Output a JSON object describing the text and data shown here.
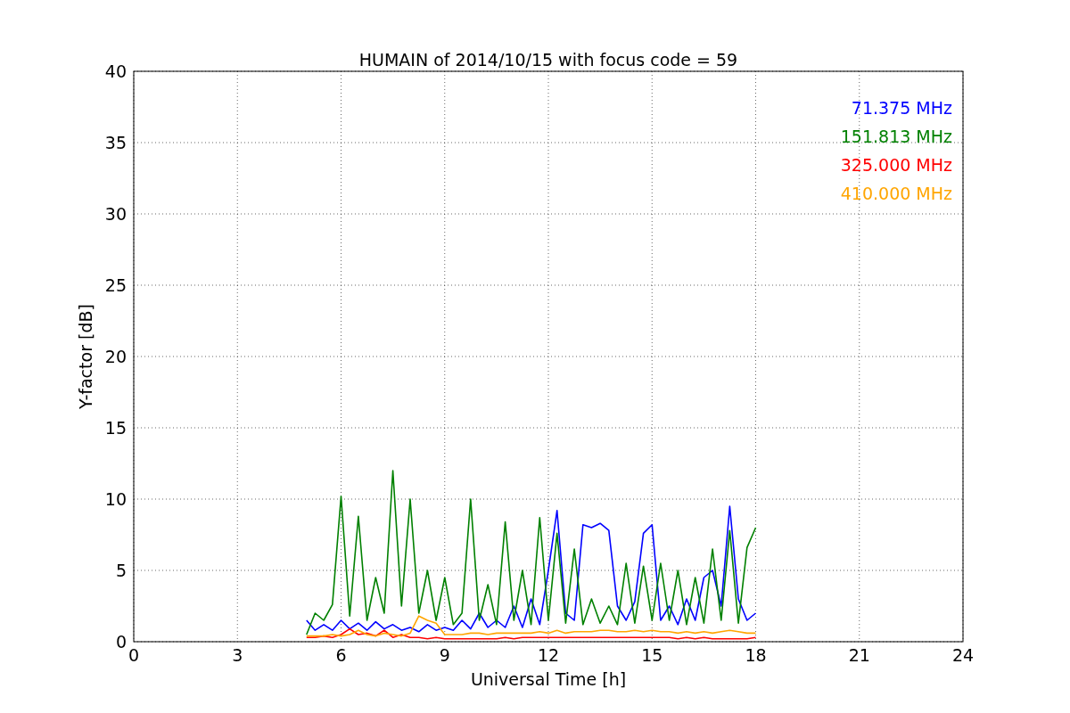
{
  "figure": {
    "chart_data": {
      "type": "line",
      "title": "HUMAIN of 2014/10/15 with focus code = 59",
      "xlabel": "Universal Time [h]",
      "ylabel": "Y-factor [dB]",
      "xlim": [
        0,
        24
      ],
      "ylim": [
        0,
        40
      ],
      "xticks": [
        0,
        3,
        6,
        9,
        12,
        15,
        18,
        21,
        24
      ],
      "yticks": [
        0,
        5,
        10,
        15,
        20,
        25,
        30,
        35,
        40
      ],
      "grid": true,
      "x": [
        5,
        5.25,
        5.5,
        5.75,
        6,
        6.25,
        6.5,
        6.75,
        7,
        7.25,
        7.5,
        7.75,
        8,
        8.25,
        8.5,
        8.75,
        9,
        9.25,
        9.5,
        9.75,
        10,
        10.25,
        10.5,
        10.75,
        11,
        11.25,
        11.5,
        11.75,
        12,
        12.25,
        12.5,
        12.75,
        13,
        13.25,
        13.5,
        13.75,
        14,
        14.25,
        14.5,
        14.75,
        15,
        15.25,
        15.5,
        15.75,
        16,
        16.25,
        16.5,
        16.75,
        17,
        17.25,
        17.5,
        17.75,
        18
      ],
      "series": [
        {
          "name": "71.375 MHz",
          "color": "#0000ff",
          "values": [
            1.5,
            0.8,
            1.2,
            0.8,
            1.5,
            0.9,
            1.3,
            0.8,
            1.4,
            0.9,
            1.2,
            0.8,
            1,
            0.7,
            1.2,
            0.8,
            1,
            0.8,
            1.5,
            0.9,
            2,
            1,
            1.5,
            1,
            2.5,
            1,
            3,
            1.2,
            5,
            9.2,
            2,
            1.5,
            8.2,
            8,
            8.3,
            7.8,
            2.5,
            1.5,
            2.8,
            7.6,
            8.2,
            1.5,
            2.5,
            1.2,
            3,
            1.5,
            4.5,
            5,
            2.5,
            9.5,
            3,
            1.5,
            2
          ]
        },
        {
          "name": "151.813 MHz",
          "color": "#008000",
          "values": [
            0.5,
            2,
            1.5,
            2.6,
            10.2,
            1.8,
            8.8,
            1.5,
            4.5,
            2,
            12,
            2.5,
            10,
            2,
            5,
            1.5,
            4.5,
            1.2,
            2,
            10,
            1.5,
            4,
            1.2,
            8.4,
            1.5,
            5,
            1.2,
            8.7,
            1.5,
            7.6,
            1.3,
            6.5,
            1.2,
            3,
            1.3,
            2.5,
            1.2,
            5.5,
            1.3,
            5.3,
            1.5,
            5.5,
            1.5,
            5,
            1.2,
            4.5,
            1.3,
            6.5,
            1.5,
            7.8,
            1.3,
            6.6,
            8
          ]
        },
        {
          "name": "325.000 MHz",
          "color": "#ff0000",
          "values": [
            0.3,
            0.3,
            0.4,
            0.3,
            0.5,
            0.9,
            0.5,
            0.6,
            0.4,
            0.8,
            0.3,
            0.5,
            0.3,
            0.3,
            0.2,
            0.3,
            0.2,
            0.2,
            0.2,
            0.2,
            0.2,
            0.2,
            0.2,
            0.3,
            0.2,
            0.3,
            0.3,
            0.3,
            0.3,
            0.3,
            0.3,
            0.3,
            0.3,
            0.3,
            0.3,
            0.3,
            0.3,
            0.3,
            0.3,
            0.3,
            0.3,
            0.3,
            0.3,
            0.2,
            0.3,
            0.2,
            0.3,
            0.2,
            0.2,
            0.2,
            0.2,
            0.2,
            0.3
          ]
        },
        {
          "name": "410.000 MHz",
          "color": "#ffa500",
          "values": [
            0.4,
            0.4,
            0.4,
            0.5,
            0.4,
            0.5,
            0.8,
            0.5,
            0.4,
            0.6,
            0.5,
            0.4,
            0.6,
            1.8,
            1.5,
            1.3,
            0.5,
            0.5,
            0.5,
            0.6,
            0.6,
            0.5,
            0.6,
            0.6,
            0.6,
            0.6,
            0.6,
            0.7,
            0.6,
            0.8,
            0.6,
            0.7,
            0.7,
            0.7,
            0.8,
            0.8,
            0.7,
            0.7,
            0.8,
            0.7,
            0.8,
            0.7,
            0.7,
            0.6,
            0.7,
            0.6,
            0.7,
            0.6,
            0.7,
            0.8,
            0.7,
            0.6,
            0.6
          ]
        }
      ]
    }
  }
}
